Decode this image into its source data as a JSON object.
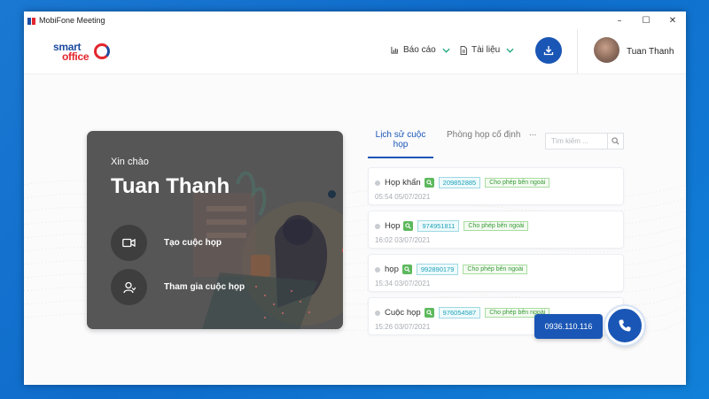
{
  "window": {
    "title": "MobiFone Meeting",
    "controls": [
      "–",
      "☐",
      "✕"
    ]
  },
  "header": {
    "logo_line1": "smart",
    "logo_line2": "office",
    "nav": [
      {
        "label": "Báo cáo",
        "icon": "bar-chart-icon"
      },
      {
        "label": "Tài liệu",
        "icon": "document-icon"
      }
    ],
    "user_name": "Tuan Thanh"
  },
  "welcome": {
    "greeting": "Xin chào",
    "name": "Tuan Thanh",
    "create_label": "Tạo cuộc họp",
    "join_label": "Tham gia cuộc họp"
  },
  "tabs": {
    "history": "Lịch sử cuộc họp",
    "fixed_rooms": "Phòng họp cố định",
    "more": "..."
  },
  "search": {
    "placeholder": "Tìm kiếm ..."
  },
  "meetings": [
    {
      "name": "Họp khẩn",
      "id": "209852885",
      "badge": "Cho phép bên ngoài",
      "time": "05:54 05/07/2021"
    },
    {
      "name": "Họp",
      "id": "974951811",
      "badge": "Cho phép bên ngoài",
      "time": "16:02 03/07/2021"
    },
    {
      "name": "họp",
      "id": "992890179",
      "badge": "Cho phép bên ngoài",
      "time": "15:34 03/07/2021"
    },
    {
      "name": "Cuộc họp",
      "id": "976054587",
      "badge": "Cho phép bên ngoài",
      "time": "15:26 03/07/2021"
    }
  ],
  "support": {
    "phone": "0936.110.116"
  },
  "colors": {
    "primary": "#1a56b5",
    "accent_green": "#1aa57a",
    "brand_red": "#e3262d",
    "card_bg": "#565656"
  }
}
